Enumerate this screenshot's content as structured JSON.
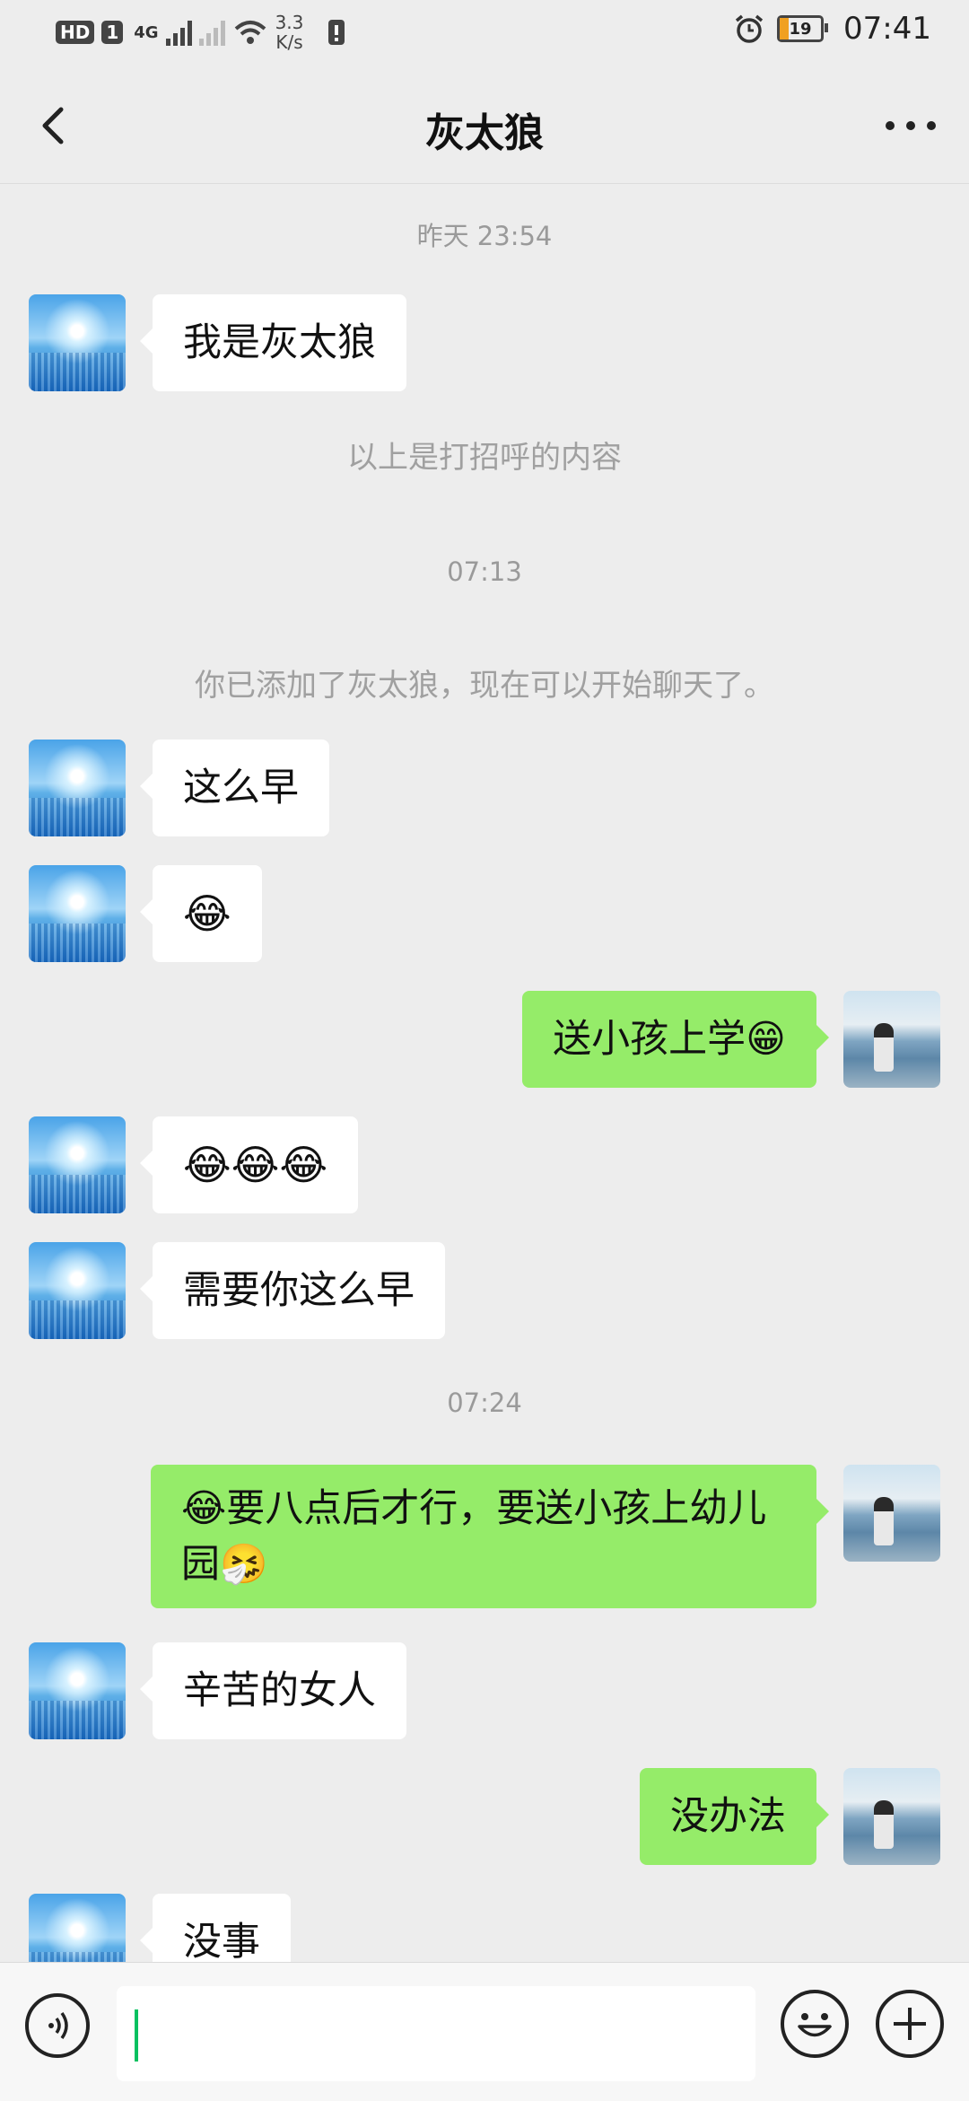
{
  "status_bar": {
    "hd": "HD",
    "sim": "1",
    "net": "4G",
    "speed_value": "3.3",
    "speed_unit": "K/s",
    "battery": "19",
    "time": "07:41"
  },
  "header": {
    "title": "灰太狼",
    "back_icon": "chevron-left-icon",
    "more_icon": "more-dots-icon"
  },
  "messages": [
    {
      "kind": "timestamp",
      "text": "昨天 23:54"
    },
    {
      "kind": "message",
      "side": "left",
      "text": "我是灰太狼"
    },
    {
      "kind": "system",
      "text": "以上是打招呼的内容"
    },
    {
      "kind": "timestamp",
      "text": "07:13"
    },
    {
      "kind": "system",
      "text": "你已添加了灰太狼，现在可以开始聊天了。"
    },
    {
      "kind": "message",
      "side": "left",
      "text": "这么早"
    },
    {
      "kind": "message",
      "side": "left",
      "text": "😂"
    },
    {
      "kind": "message",
      "side": "right",
      "text": "送小孩上学😁"
    },
    {
      "kind": "message",
      "side": "left",
      "text": "😂😂😂"
    },
    {
      "kind": "message",
      "side": "left",
      "text": "需要你这么早"
    },
    {
      "kind": "timestamp",
      "text": "07:24"
    },
    {
      "kind": "message",
      "side": "right",
      "text": "😂要八点后才行，要送小孩上幼儿园🤧"
    },
    {
      "kind": "message",
      "side": "left",
      "text": "辛苦的女人"
    },
    {
      "kind": "message",
      "side": "right",
      "text": "没办法"
    },
    {
      "kind": "message",
      "side": "left",
      "text": "没事"
    }
  ],
  "input_bar": {
    "voice_icon": "voice-icon",
    "emoji_icon": "emoji-icon",
    "plus_icon": "plus-icon"
  }
}
